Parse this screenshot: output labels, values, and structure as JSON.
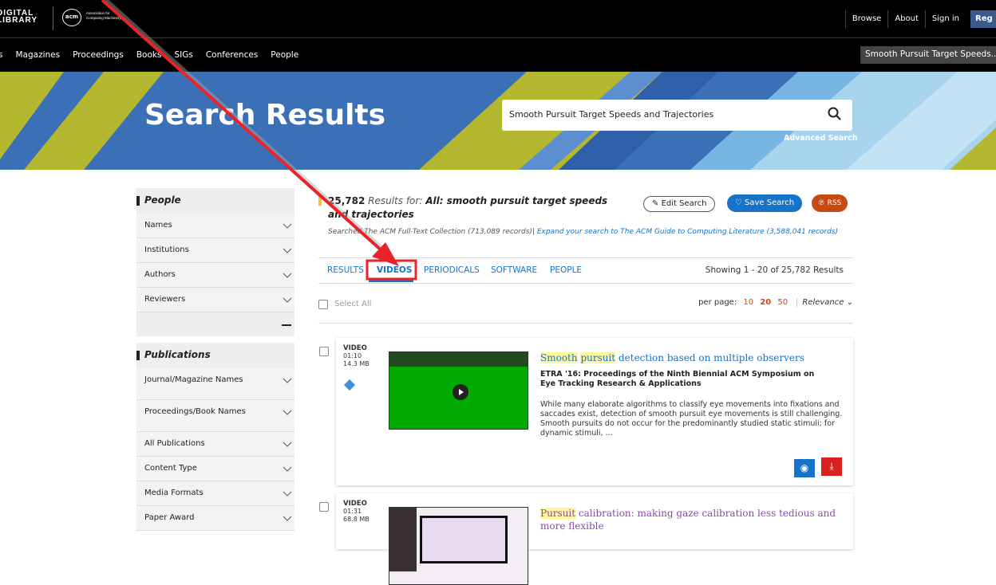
{
  "topbar": {
    "logo_line1": "DIGITAL",
    "logo_line2": "LIBRARY",
    "acm_badge": "acm",
    "acm_line1": "Association for",
    "acm_line2": "Computing Machinery",
    "links": [
      "Browse",
      "About",
      "Sign in"
    ],
    "register": "Reg"
  },
  "nav": {
    "items": [
      "s",
      "Magazines",
      "Proceedings",
      "Books",
      "SIGs",
      "Conferences",
      "People"
    ],
    "search_mini": "Smooth Pursuit Target Speeds..."
  },
  "hero": {
    "title": "Search Results",
    "search_value": "Smooth Pursuit Target Speeds and Trajectories",
    "advanced": "Advanced Search",
    "search_icon": "search-icon"
  },
  "sidebar": {
    "people_heading": "People",
    "people_items": [
      "Names",
      "Institutions",
      "Authors",
      "Reviewers"
    ],
    "pub_heading": "Publications",
    "pub_items": [
      "Journal/Magazine Names",
      "Proceedings/Book Names",
      "All Publications",
      "Content Type",
      "Media Formats",
      "Paper Award"
    ]
  },
  "results": {
    "count": "25,782",
    "label": "Results for:",
    "query": "All: smooth pursuit target speeds and trajectories",
    "searched": "Searched The ACM Full-Text Collection (713,089 records)|",
    "expand": "Expand your search to The ACM Guide to Computing Literature (3,588,041 records)",
    "edit": "Edit Search",
    "save": "Save Search",
    "rss": "RSS"
  },
  "tabs": {
    "items": [
      "RESULTS",
      "VIDEOS",
      "PERIODICALS",
      "SOFTWARE",
      "PEOPLE"
    ],
    "active": "VIDEOS",
    "showing": "Showing 1 - 20 of 25,782 Results"
  },
  "controls": {
    "select_all": "Select All",
    "per_page_label": "per page:",
    "per_page": [
      "10",
      "20",
      "50"
    ],
    "per_page_current": "20",
    "sort": "Relevance"
  },
  "cards": [
    {
      "type": "VIDEO",
      "duration": "01:10",
      "size": "14.3 MB",
      "title_hl1": "Smooth",
      "title_hl2": "pursuit",
      "title_rest": "detection based on multiple observers",
      "venue": "ETRA '16: Proceedings of the Ninth Biennial ACM Symposium on Eye Tracking Research & Applications",
      "abstract": "While many elaborate algorithms to classify eye movements into fixations and saccades exist, detection of smooth pursuit eye movements is still challenging. Smooth pursuits do not occur for the predominantly studied static stimuli; for dynamic stimuli, ..."
    },
    {
      "type": "VIDEO",
      "duration": "01:31",
      "size": "68.8 MB",
      "title_hl1": "Pursuit",
      "title_rest": "calibration: making gaze calibration less tedious and more flexible"
    }
  ],
  "colors": {
    "accent_blue": "#1673c8",
    "rss_orange": "#c74a10",
    "hero_blue": "#3b6fb6",
    "hero_olive": "#b4b82e",
    "annotation_red": "#e8242a"
  }
}
